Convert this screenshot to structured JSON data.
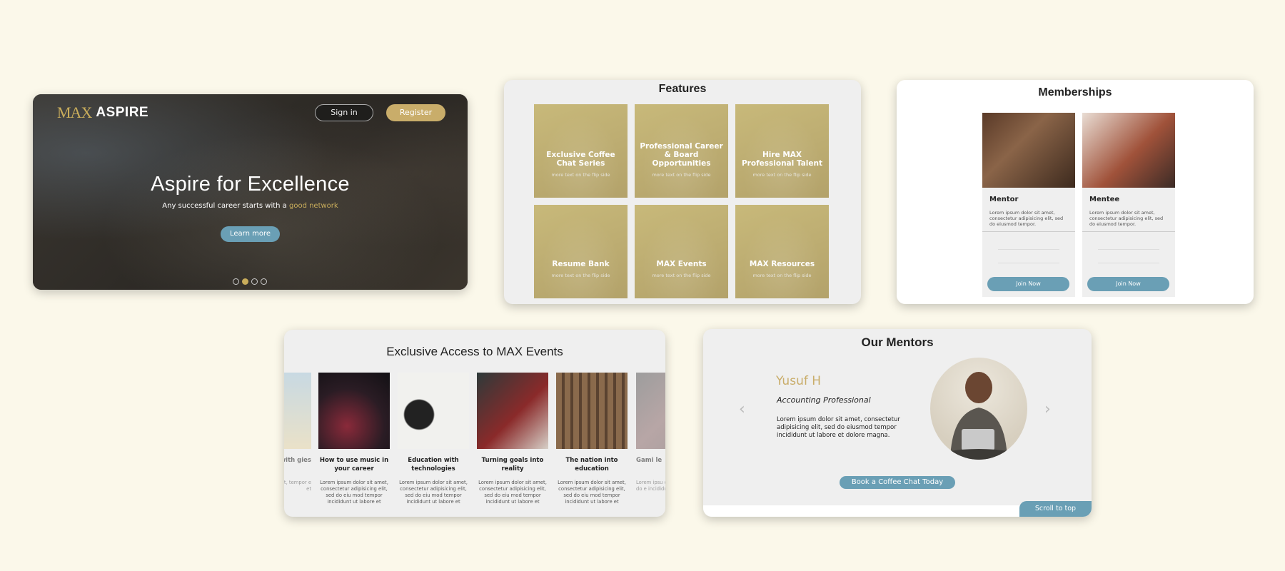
{
  "hero": {
    "logo_mark": "MAX",
    "logo_text": "ASPIRE",
    "signin_label": "Sign in",
    "register_label": "Register",
    "headline": "Aspire for Excellence",
    "subline_prefix": "Any successful career starts with a",
    "subline_highlight": "good network",
    "cta_label": "Learn more",
    "carousel_active_index": 1,
    "carousel_count": 4
  },
  "features": {
    "title": "Features",
    "tiles": [
      {
        "title": "Exclusive Coffee Chat Series",
        "subtitle": "more text on the flip side"
      },
      {
        "title": "Professional Career & Board Opportunities",
        "subtitle": "more text on the flip side"
      },
      {
        "title": "Hire MAX Professional Talent",
        "subtitle": "more text on the flip side"
      },
      {
        "title": "Resume Bank",
        "subtitle": "more text on the flip side"
      },
      {
        "title": "MAX Events",
        "subtitle": "more text on the flip side"
      },
      {
        "title": "MAX Resources",
        "subtitle": "more text on the flip side"
      }
    ]
  },
  "memberships": {
    "title": "Memberships",
    "plans": [
      {
        "name": "Mentor",
        "description": "Lorem ipsum dolor sit amet, consectetur adipisicing elit, sed do eiusmod tempor.",
        "button": "Join Now"
      },
      {
        "name": "Mentee",
        "description": "Lorem ipsum dolor sit amet, consectetur adipisicing elit, sed do eiusmod tempor.",
        "button": "Join Now"
      }
    ]
  },
  "events": {
    "title": "Exclusive Access to MAX Events",
    "items": [
      {
        "title": "with gies",
        "description": "sit amet, cing elit, tempor e et"
      },
      {
        "title": "How to use music in your career",
        "description": "Lorem ipsum dolor sit amet, consectetur adipisicing elit, sed do eiu mod tempor incididunt ut labore et"
      },
      {
        "title": "Education with technologies",
        "description": "Lorem ipsum dolor sit amet, consectetur adipisicing elit, sed do eiu mod tempor incididunt ut labore et"
      },
      {
        "title": "Turning goals into reality",
        "description": "Lorem ipsum dolor sit amet, consectetur adipisicing elit, sed do eiu mod tempor incididunt ut labore et"
      },
      {
        "title": "The nation into education",
        "description": "Lorem ipsum dolor sit amet, consectetur adipisicing elit, sed do eiu mod tempor incididunt ut labore et"
      },
      {
        "title": "Gami le",
        "description": "Lorem ipsu consectetu sed do e incididu"
      }
    ]
  },
  "mentors": {
    "title": "Our Mentors",
    "name": "Yusuf H",
    "role": "Accounting Professional",
    "bio": "Lorem ipsum dolor sit amet, consectetur adipisicing elit, sed do eiusmod tempor incididunt ut labore et dolore magna.",
    "book_label": "Book a Coffee Chat Today",
    "scroll_top_label": "Scroll to top",
    "prev_icon": "‹",
    "next_icon": "›"
  }
}
